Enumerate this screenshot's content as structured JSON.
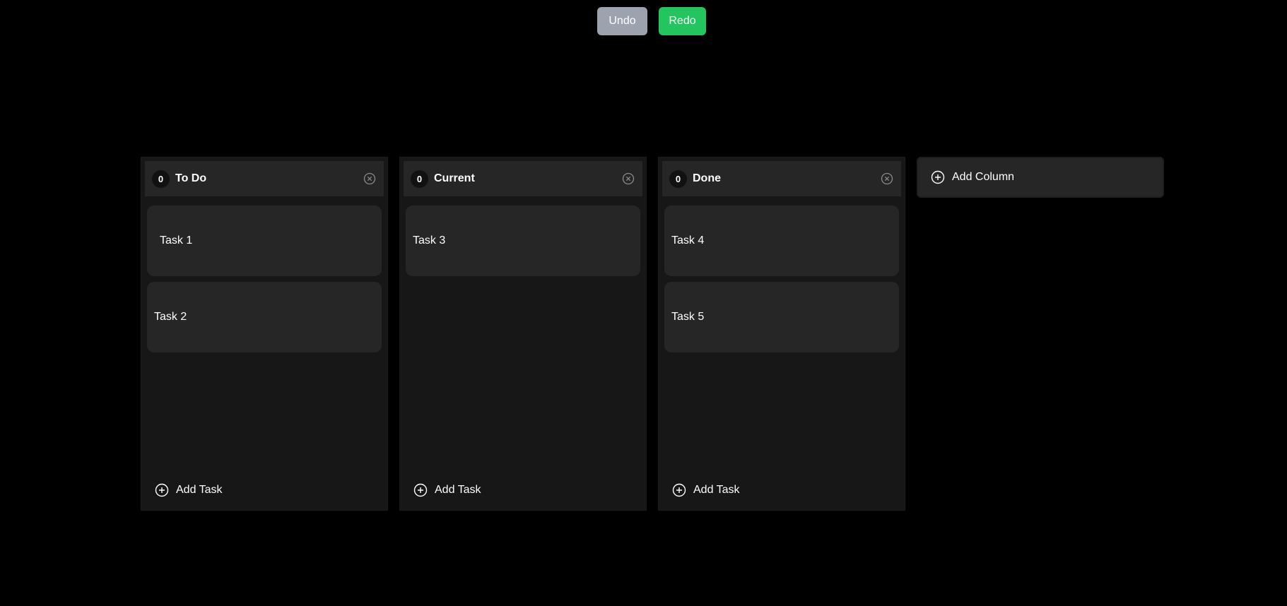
{
  "toolbar": {
    "undo_label": "Undo",
    "redo_label": "Redo",
    "undo_color": "#9ca3af",
    "redo_color": "#22c55e"
  },
  "columns": [
    {
      "title": "To Do",
      "count": "0",
      "tasks": [
        {
          "label": "Task 1"
        },
        {
          "label": "Task 2"
        }
      ],
      "add_task_label": "Add Task"
    },
    {
      "title": "Current",
      "count": "0",
      "tasks": [
        {
          "label": "Task 3"
        }
      ],
      "add_task_label": "Add Task"
    },
    {
      "title": "Done",
      "count": "0",
      "tasks": [
        {
          "label": "Task 4"
        },
        {
          "label": "Task 5"
        }
      ],
      "add_task_label": "Add Task"
    }
  ],
  "add_column_label": "Add Column",
  "icons": {
    "close": "close-circle-icon",
    "add": "plus-circle-icon"
  },
  "colors": {
    "background": "#000000",
    "column": "#171717",
    "card": "#262626",
    "accent": "#22c55e"
  }
}
